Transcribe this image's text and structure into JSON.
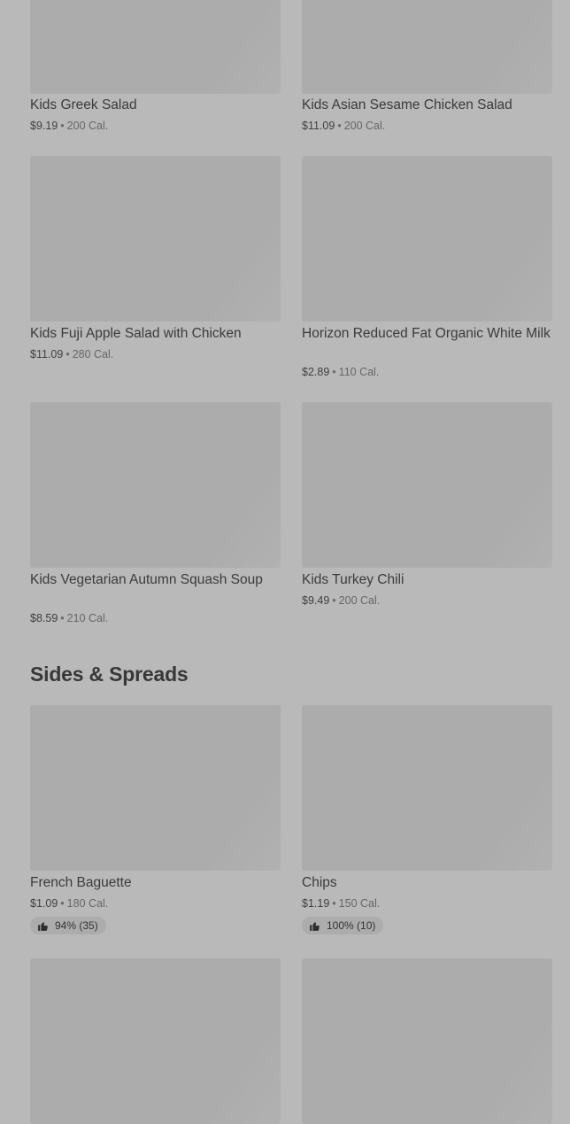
{
  "sections": [
    {
      "items": [
        {
          "name": "Kids Greek Salad",
          "price": "$9.19",
          "calories": "200 Cal."
        },
        {
          "name": "Kids Asian Sesame Chicken Salad",
          "price": "$11.09",
          "calories": "200 Cal."
        },
        {
          "name": "Kids Fuji Apple Salad with Chicken",
          "price": "$11.09",
          "calories": "280 Cal."
        },
        {
          "name": "Horizon Reduced Fat Organic White Milk",
          "price": "$2.89",
          "calories": "110 Cal."
        },
        {
          "name": "Kids Vegetarian Autumn Squash Soup",
          "price": "$8.59",
          "calories": "210 Cal."
        },
        {
          "name": "Kids Turkey Chili",
          "price": "$9.49",
          "calories": "200 Cal."
        }
      ]
    },
    {
      "title": "Sides & Spreads",
      "items": [
        {
          "name": "French Baguette",
          "price": "$1.09",
          "calories": "180 Cal.",
          "rating": "94% (35)"
        },
        {
          "name": "Chips",
          "price": "$1.19",
          "calories": "150 Cal.",
          "rating": "100% (10)"
        }
      ]
    }
  ],
  "separator": "•",
  "icons": {
    "rating": "thumbs-up-icon"
  }
}
